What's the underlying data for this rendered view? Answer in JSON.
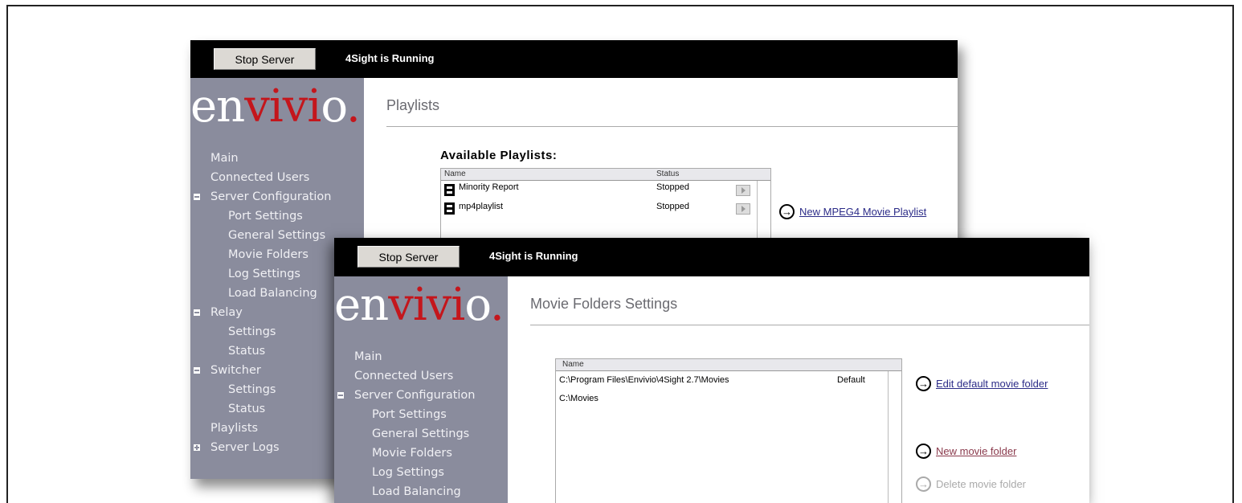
{
  "back_window": {
    "header": {
      "stop_button": "Stop Server",
      "status": "4Sight is Running"
    },
    "logo": {
      "part1": "en",
      "part2": "vivi",
      "part3": "o",
      "dot": "."
    },
    "nav": [
      {
        "label": "Main",
        "level": 0
      },
      {
        "label": "Connected Users",
        "level": 0
      },
      {
        "label": "Server Configuration",
        "level": 0,
        "expander": "minus"
      },
      {
        "label": "Port Settings",
        "level": 1
      },
      {
        "label": "General Settings",
        "level": 1
      },
      {
        "label": "Movie Folders",
        "level": 1
      },
      {
        "label": "Log Settings",
        "level": 1
      },
      {
        "label": "Load Balancing",
        "level": 1
      },
      {
        "label": "Relay",
        "level": 0,
        "expander": "minus"
      },
      {
        "label": "Settings",
        "level": 1
      },
      {
        "label": "Status",
        "level": 1
      },
      {
        "label": "Switcher",
        "level": 0,
        "expander": "minus"
      },
      {
        "label": "Settings",
        "level": 1
      },
      {
        "label": "Status",
        "level": 1
      },
      {
        "label": "Playlists",
        "level": 0
      },
      {
        "label": "Server Logs",
        "level": 0,
        "expander": "plus"
      }
    ],
    "page_title": "Playlists",
    "section_title": "Available Playlists:",
    "table": {
      "columns": [
        "Name",
        "Status"
      ],
      "rows": [
        {
          "name": "Minority Report",
          "status": "Stopped"
        },
        {
          "name": "mp4playlist",
          "status": "Stopped"
        }
      ]
    },
    "actions": {
      "new_playlist": "New MPEG4 Movie Playlist"
    }
  },
  "front_window": {
    "header": {
      "stop_button": "Stop Server",
      "status": "4Sight is Running"
    },
    "logo": {
      "part1": "en",
      "part2": "vivi",
      "part3": "o",
      "dot": "."
    },
    "nav": [
      {
        "label": "Main",
        "level": 0
      },
      {
        "label": "Connected Users",
        "level": 0
      },
      {
        "label": "Server Configuration",
        "level": 0,
        "expander": "minus"
      },
      {
        "label": "Port Settings",
        "level": 1
      },
      {
        "label": "General Settings",
        "level": 1
      },
      {
        "label": "Movie Folders",
        "level": 1
      },
      {
        "label": "Log Settings",
        "level": 1
      },
      {
        "label": "Load Balancing",
        "level": 1
      }
    ],
    "page_title": "Movie Folders Settings",
    "table": {
      "columns": [
        "Name"
      ],
      "rows": [
        {
          "name": "C:\\Program Files\\Envivio\\4Sight 2.7\\Movies",
          "tag": "Default"
        },
        {
          "name": "C:\\Movies",
          "tag": ""
        }
      ]
    },
    "actions": {
      "edit_default": "Edit default movie folder",
      "new_folder": "New movie folder",
      "delete_folder": "Delete movie folder"
    }
  },
  "colors": {
    "sidebar": "#8a8c9d",
    "topbar": "#000000",
    "logo_red": "#c4161c"
  },
  "icons": [
    "circle-arrow-icon",
    "film-icon",
    "play-icon"
  ]
}
